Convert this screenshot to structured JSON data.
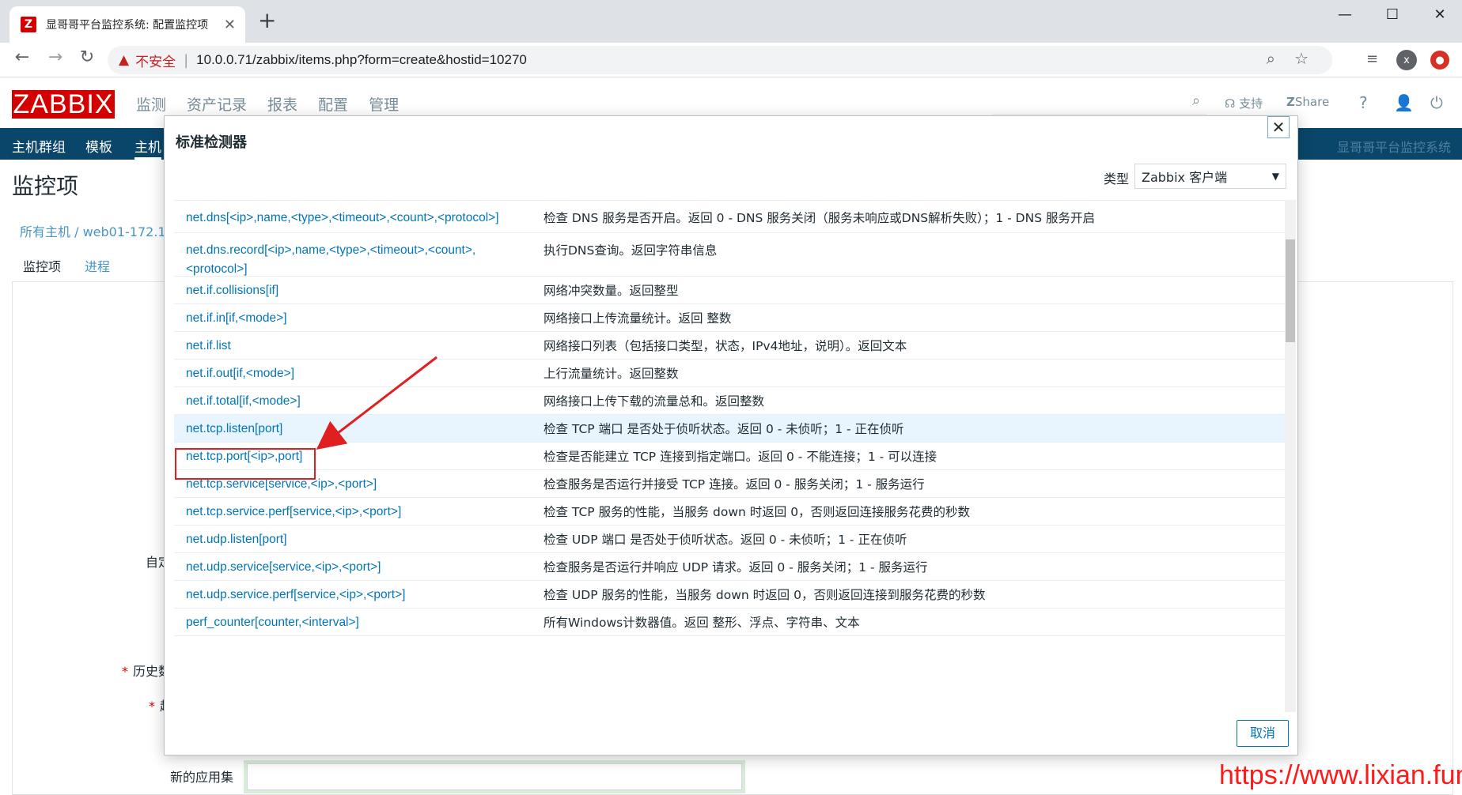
{
  "browser": {
    "tab_title": "显哥哥平台监控系统: 配置监控项",
    "tab_close": "✕",
    "new_tab": "+",
    "window": {
      "minimize": "—",
      "maximize": "☐",
      "close": "✕"
    },
    "nav": {
      "back": "←",
      "forward": "→",
      "reload": "↻"
    },
    "insecure_label": "不安全",
    "url": "10.0.0.71/zabbix/items.php?form=create&hostid=10270",
    "avatar_letter": "x",
    "favicon_letter": "Z"
  },
  "zabbix": {
    "logo": "ZABBIX",
    "menu": [
      "监测",
      "资产记录",
      "报表",
      "配置",
      "管理"
    ],
    "support": "支持",
    "share": "Share",
    "help": "?",
    "subnav": [
      "主机群组",
      "模板",
      "主机"
    ],
    "brand": "显哥哥平台监控系统",
    "page_title": "监控项",
    "breadcrumb": "所有主机 / web01-172.1",
    "tabs": [
      "监控项",
      "进程"
    ],
    "form_labels": {
      "custom_interval": "自定",
      "history": "历史数",
      "trend": "趋",
      "new_application": "新的应用集"
    }
  },
  "modal": {
    "title": "标准检测器",
    "close": "✕",
    "type_label": "类型",
    "type_value": "Zabbix 客户端",
    "cancel": "取消",
    "rows": [
      {
        "key": "net.dns[<ip>,name,<type>,<timeout>,<count>,<protocol>]",
        "desc": "检查 DNS 服务是否开启。返回 0 - DNS 服务关闭（服务未响应或DNS解析失败）；1 - DNS 服务开启"
      },
      {
        "key": "net.dns.record[<ip>,name,<type>,<timeout>,<count>,<protocol>]",
        "desc": "执行DNS查询。返回字符串信息"
      },
      {
        "key": "net.if.collisions[if]",
        "desc": "网络冲突数量。返回整型"
      },
      {
        "key": "net.if.in[if,<mode>]",
        "desc": "网络接口上传流量统计。返回 整数"
      },
      {
        "key": "net.if.list",
        "desc": "网络接口列表（包括接口类型，状态，IPv4地址，说明）。返回文本"
      },
      {
        "key": "net.if.out[if,<mode>]",
        "desc": "上行流量统计。返回整数"
      },
      {
        "key": "net.if.total[if,<mode>]",
        "desc": "网络接口上传下载的流量总和。返回整数"
      },
      {
        "key": "net.tcp.listen[port]",
        "desc": "检查 TCP 端口 是否处于侦听状态。返回 0 - 未侦听；1 - 正在侦听"
      },
      {
        "key": "net.tcp.port[<ip>,port]",
        "desc": "检查是否能建立 TCP 连接到指定端口。返回 0 - 不能连接；1 - 可以连接"
      },
      {
        "key": "net.tcp.service[service,<ip>,<port>]",
        "desc": "检查服务是否运行并接受 TCP 连接。返回 0 - 服务关闭；1 - 服务运行"
      },
      {
        "key": "net.tcp.service.perf[service,<ip>,<port>]",
        "desc": "检查 TCP 服务的性能，当服务 down 时返回 0，否则返回连接服务花费的秒数"
      },
      {
        "key": "net.udp.listen[port]",
        "desc": "检查 UDP 端口 是否处于侦听状态。返回 0 - 未侦听；1 - 正在侦听"
      },
      {
        "key": "net.udp.service[service,<ip>,<port>]",
        "desc": "检查服务是否运行并响应 UDP 请求。返回 0 - 服务关闭；1 - 服务运行"
      },
      {
        "key": "net.udp.service.perf[service,<ip>,<port>]",
        "desc": "检查 UDP 服务的性能，当服务 down 时返回 0，否则返回连接到服务花费的秒数"
      },
      {
        "key": "perf_counter[counter,<interval>]",
        "desc": "所有Windows计数器值。返回 整形、浮点、字符串、文本"
      }
    ],
    "highlighted_row": "net.tcp.listen[port]"
  },
  "watermark": "https://www.lixian.fun",
  "colors": {
    "zabbix_red": "#d40000",
    "subnav_blue": "#0a466a",
    "link_blue": "#0275b8",
    "annotation_red": "#e02020"
  }
}
